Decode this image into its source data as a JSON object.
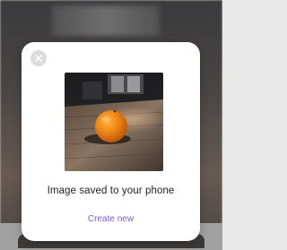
{
  "dialog": {
    "close_icon": "close-icon",
    "preview_subject": "orange-on-wooden-table-photo",
    "caption": "Image saved to your phone",
    "create_new_label": "Create new"
  },
  "colors": {
    "accent": "#7b5cd6",
    "dialog_background": "#ffffff",
    "caption_text": "#222222"
  }
}
